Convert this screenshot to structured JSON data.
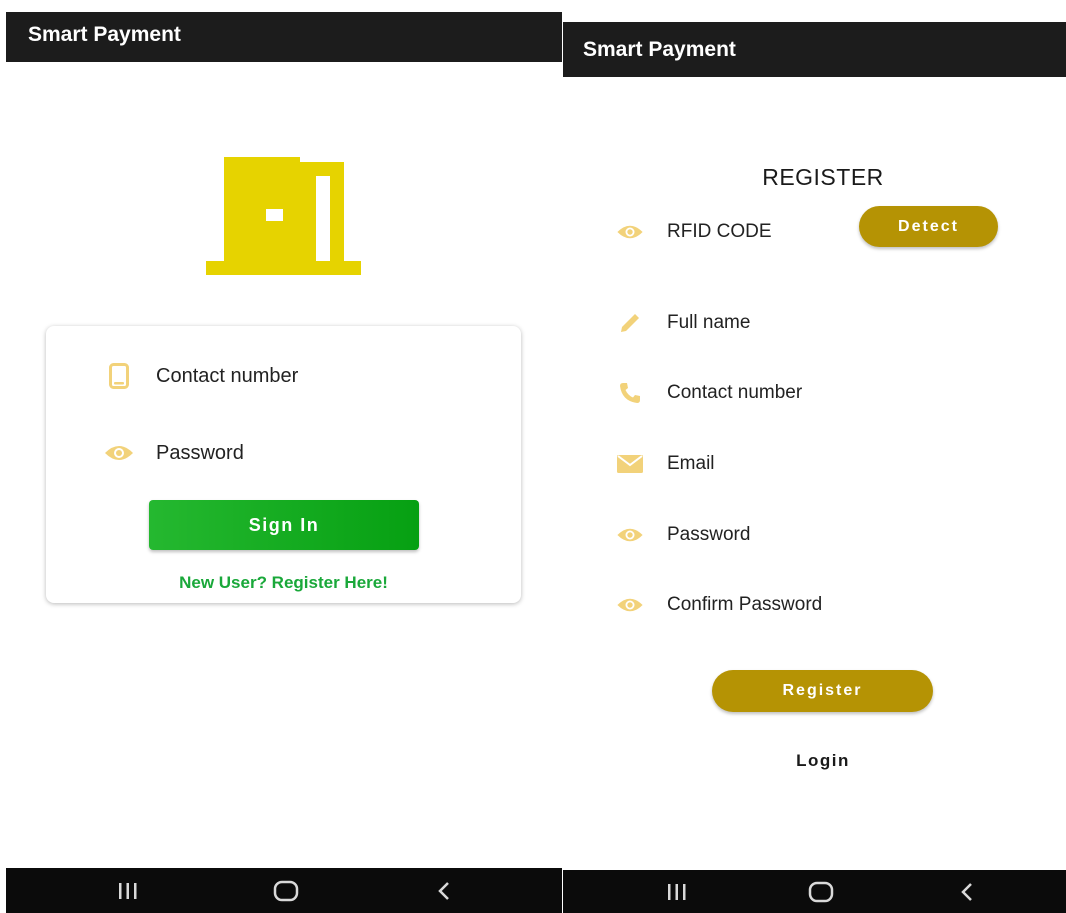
{
  "login_screen": {
    "app_title": "Smart Payment",
    "contact_label": "Contact number",
    "password_label": "Password",
    "signin_label": "Sign In",
    "register_link": "New User? Register Here!",
    "colors": {
      "logo": "#e6d300",
      "signin": "#1aa82a",
      "link": "#1aa83a",
      "icon": "#f2d27a"
    },
    "icons": [
      "door-logo-icon",
      "phone-icon",
      "eye-icon"
    ]
  },
  "register_screen": {
    "app_title": "Smart Payment",
    "heading": "REGISTER",
    "rfid_label": "RFID CODE",
    "detect_label": "Detect",
    "fullname_label": "Full name",
    "contact_label": "Contact number",
    "email_label": "Email",
    "password_label": "Password",
    "confirm_password_label": "Confirm Password",
    "register_label": "Register",
    "login_label": "Login",
    "colors": {
      "button": "#b59304",
      "icon": "#f2d27a"
    },
    "icons": [
      "eye-icon",
      "pencil-icon",
      "phone-icon",
      "mail-icon",
      "eye-icon",
      "eye-icon"
    ]
  },
  "navbar": {
    "icons": [
      "recent-apps-icon",
      "home-icon",
      "back-icon"
    ]
  }
}
